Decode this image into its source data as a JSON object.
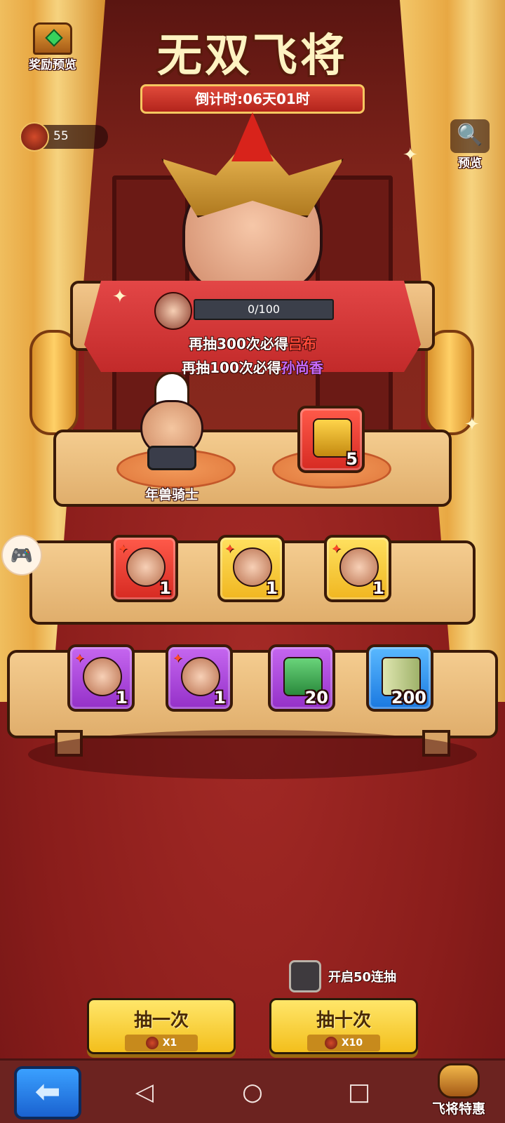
{
  "header": {
    "title": "无双飞将",
    "countdown": "倒计时:06天01时",
    "reward_preview_label": "奖励预览",
    "preview_label": "预览"
  },
  "currency": {
    "amount": "55"
  },
  "progress": {
    "text": "0/100",
    "fraction": 0
  },
  "guarantee": {
    "line1_prefix": "再抽300次必得",
    "line1_name": "吕布",
    "line2_prefix": "再抽100次必得",
    "line2_name": "孙尚香"
  },
  "featured": {
    "knight_name": "年兽骑士",
    "seal_count": "5"
  },
  "row2_items": [
    {
      "count": "1",
      "color": "red"
    },
    {
      "count": "1",
      "color": "yellow"
    },
    {
      "count": "1",
      "color": "yellow"
    }
  ],
  "row3_items": [
    {
      "count": "1",
      "color": "purple"
    },
    {
      "count": "1",
      "color": "purple"
    },
    {
      "count": "20",
      "color": "purple"
    },
    {
      "count": "200",
      "color": "blue"
    }
  ],
  "controls": {
    "multi_draw_label": "开启50连抽",
    "multi_draw_checked": false,
    "draw_once_label": "抽一次",
    "draw_once_cost": "X1",
    "draw_ten_label": "抽十次",
    "draw_ten_cost": "X10"
  },
  "navbar": {
    "promo_label": "飞将特惠",
    "back_icon": "arrow-left-icon",
    "sys_back_icon": "triangle-back-icon",
    "sys_home_icon": "circle-home-icon",
    "sys_recents_icon": "square-recents-icon"
  },
  "colors": {
    "background": "#8e1f1f",
    "accent_yellow": "#f3bf1c",
    "highlight_red": "#ff4a3a",
    "highlight_purple": "#c56bff"
  }
}
